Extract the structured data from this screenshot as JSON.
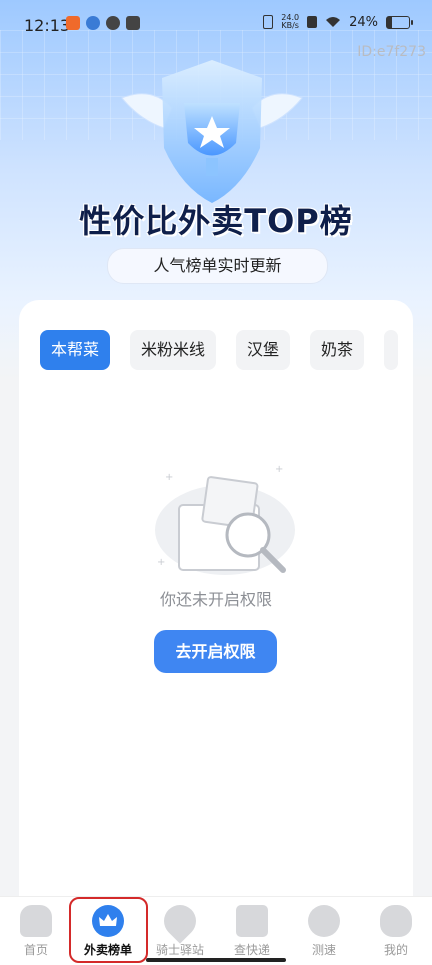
{
  "status_bar": {
    "time": "12:13",
    "speed_value": "24.0",
    "speed_unit": "KB/s",
    "battery": "24%",
    "battery_level": 0.24
  },
  "id_label": "ID:e7f273",
  "hero": {
    "title": "性价比外卖TOP榜",
    "subtitle": "人气榜单实时更新"
  },
  "tabs": [
    {
      "label": "本帮菜",
      "active": true
    },
    {
      "label": "米粉米线",
      "active": false
    },
    {
      "label": "汉堡",
      "active": false
    },
    {
      "label": "奶茶",
      "active": false
    }
  ],
  "empty_state": {
    "message": "你还未开启权限",
    "button_label": "去开启权限"
  },
  "bottom_nav": [
    {
      "label": "首页",
      "icon": "home-icon"
    },
    {
      "label": "外卖榜单",
      "icon": "crown-icon",
      "active": true
    },
    {
      "label": "骑士驿站",
      "icon": "location-pin-icon"
    },
    {
      "label": "查快递",
      "icon": "package-icon"
    },
    {
      "label": "测速",
      "icon": "speedometer-icon"
    },
    {
      "label": "我的",
      "icon": "profile-icon"
    }
  ],
  "colors": {
    "accent": "#2f80ed",
    "highlight": "#d42a2a"
  }
}
